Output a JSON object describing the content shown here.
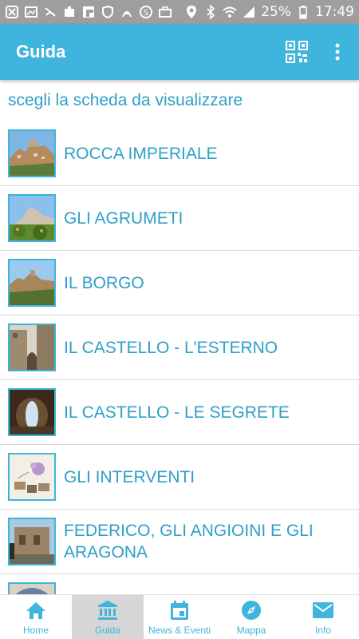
{
  "status_bar": {
    "battery": "25%",
    "time": "17:49"
  },
  "app_bar": {
    "title": "Guida",
    "qr_icon": "qr-code-icon",
    "more_icon": "more-vert-icon"
  },
  "subtitle": "scegli la scheda da visualizzare",
  "items": [
    {
      "label": "ROCCA IMPERIALE",
      "thumb": "town-photo"
    },
    {
      "label": "GLI AGRUMETI",
      "thumb": "citrus-photo"
    },
    {
      "label": "IL BORGO",
      "thumb": "village-photo"
    },
    {
      "label": "IL CASTELLO - L'ESTERNO",
      "thumb": "castle-exterior-photo"
    },
    {
      "label": "IL CASTELLO - LE SEGRETE",
      "thumb": "dungeon-photo"
    },
    {
      "label": "GLI INTERVENTI",
      "thumb": "works-photo"
    },
    {
      "label": "FEDERICO, GLI ANGIOINI E GLI ARAGONA",
      "thumb": "courtyard-photo"
    }
  ],
  "nav": [
    {
      "label": "Home",
      "icon": "home-icon",
      "active": false
    },
    {
      "label": "Guida",
      "icon": "museum-icon",
      "active": true
    },
    {
      "label": "News & Eventi",
      "icon": "calendar-icon",
      "active": false
    },
    {
      "label": "Mappa",
      "icon": "compass-icon",
      "active": false
    },
    {
      "label": "Info",
      "icon": "mail-icon",
      "active": false
    }
  ],
  "colors": {
    "accent": "#3fb5dd",
    "text_accent": "#2f9fc7",
    "status_bar": "#9e9e9e"
  }
}
